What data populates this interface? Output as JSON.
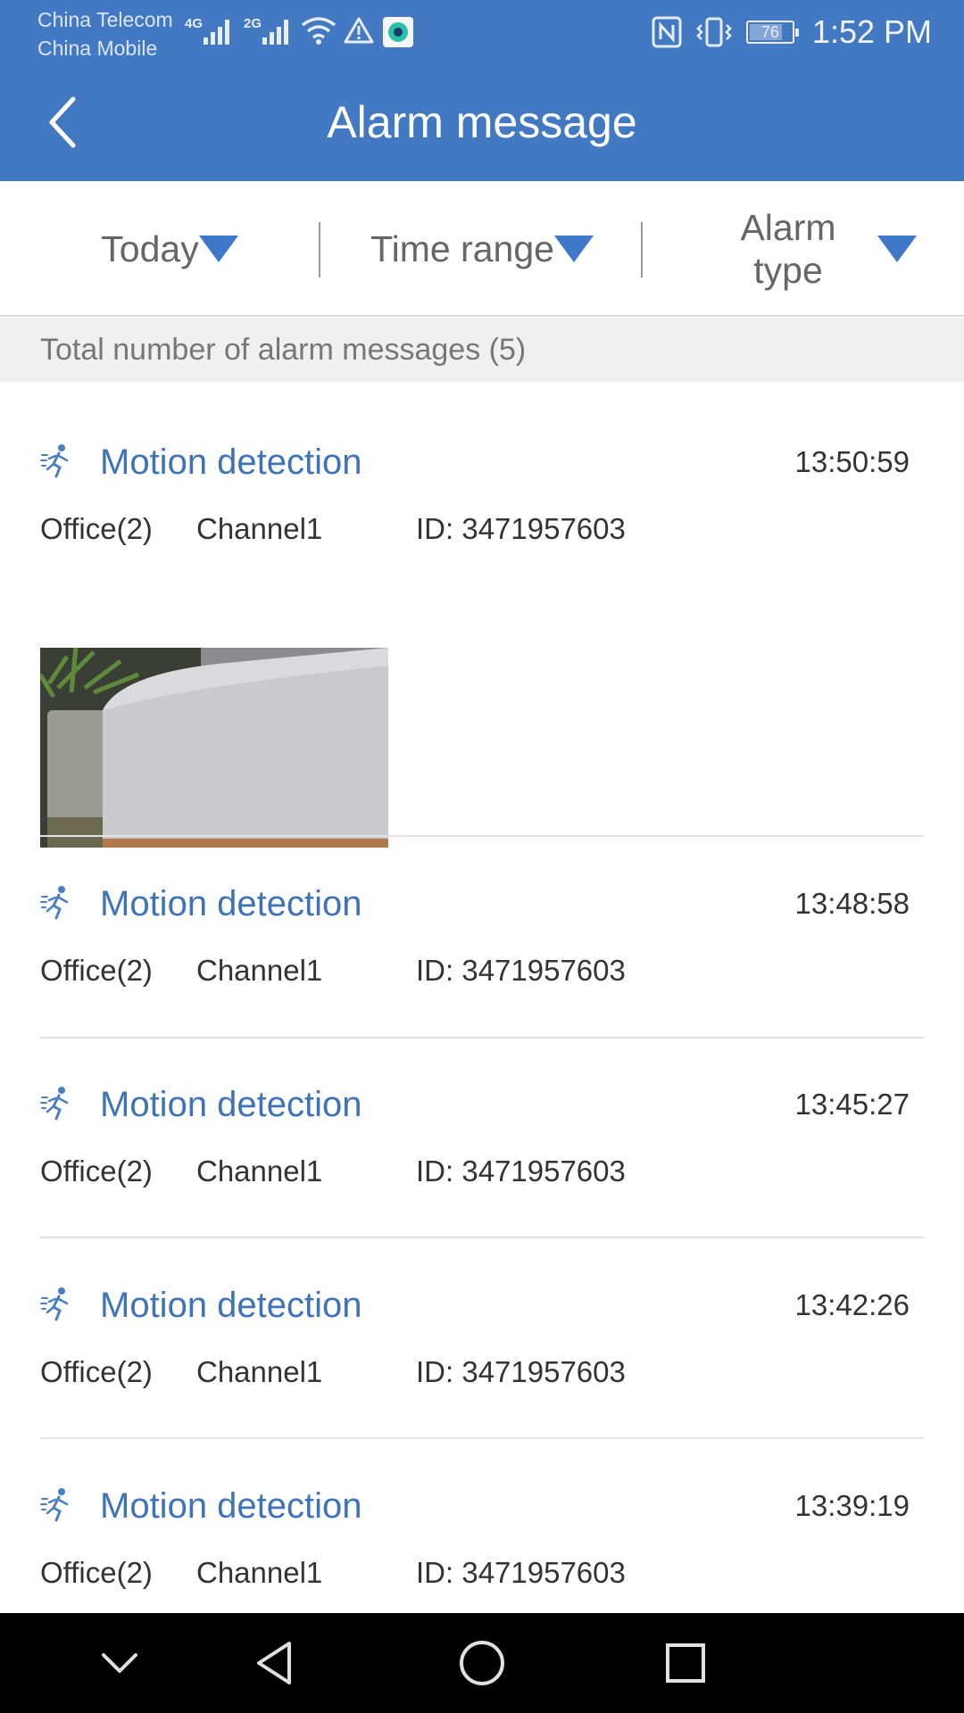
{
  "status_bar": {
    "carrier_1": "China Telecom",
    "carrier_2": "China Mobile",
    "network_1": "4G",
    "network_2": "2G",
    "battery_level": "76",
    "time": "1:52 PM"
  },
  "app_bar": {
    "title": "Alarm message"
  },
  "filters": {
    "date": "Today",
    "time_range": "Time range",
    "alarm_type_line1": "Alarm",
    "alarm_type_line2": "type"
  },
  "summary": "Total number of alarm messages (5)",
  "alarms": [
    {
      "type": "Motion detection",
      "time": "13:50:59",
      "location": "Office(2)",
      "channel": "Channel1",
      "device_id": "ID: 3471957603"
    },
    {
      "type": "Motion detection",
      "time": "13:48:58",
      "location": "Office(2)",
      "channel": "Channel1",
      "device_id": "ID: 3471957603"
    },
    {
      "type": "Motion detection",
      "time": "13:45:27",
      "location": "Office(2)",
      "channel": "Channel1",
      "device_id": "ID: 3471957603"
    },
    {
      "type": "Motion detection",
      "time": "13:42:26",
      "location": "Office(2)",
      "channel": "Channel1",
      "device_id": "ID: 3471957603"
    },
    {
      "type": "Motion detection",
      "time": "13:39:19",
      "location": "Office(2)",
      "channel": "Channel1",
      "device_id": "ID: 3471957603"
    }
  ],
  "colors": {
    "header": "#4279c2",
    "accent": "#3f78c8",
    "title_text": "#3f73b8"
  },
  "icons": {
    "back": "chevron-left-icon",
    "motion": "running-person-icon",
    "filter_dropdown": "triangle-down-icon"
  }
}
